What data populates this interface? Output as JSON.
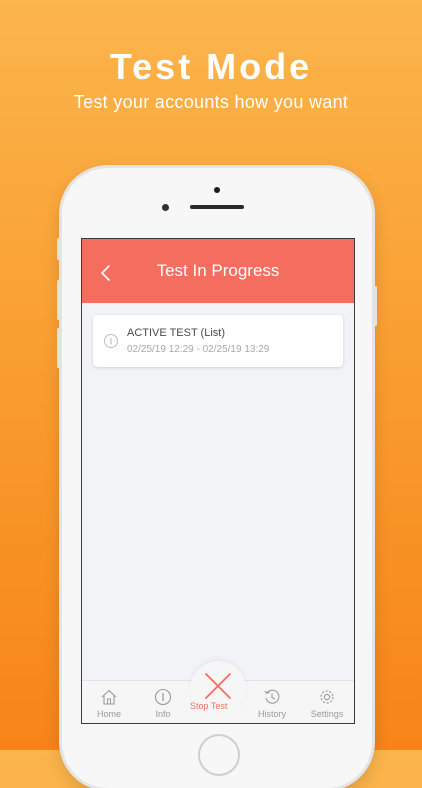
{
  "promo": {
    "title": "Test Mode",
    "subtitle": "Test your accounts how you want"
  },
  "header": {
    "title": "Test In Progress",
    "back_icon": "chevron-left-icon"
  },
  "test_card": {
    "title": "ACTIVE TEST (List)",
    "dates": "02/25/19 12:29 - 02/25/19 13:29",
    "icon": "info-circle-icon"
  },
  "tabbar": {
    "tabs": [
      {
        "label": "Home",
        "icon": "home-icon"
      },
      {
        "label": "Info",
        "icon": "info-icon"
      },
      {
        "label": "Stop Test",
        "icon": "close-icon",
        "active": true
      },
      {
        "label": "History",
        "icon": "history-icon"
      },
      {
        "label": "Settings",
        "icon": "gear-icon"
      }
    ]
  },
  "colors": {
    "accent": "#f56d5f",
    "background_top": "#fbb54c",
    "background_bottom": "#f7841a",
    "tab_inactive": "#9a9a9a"
  }
}
